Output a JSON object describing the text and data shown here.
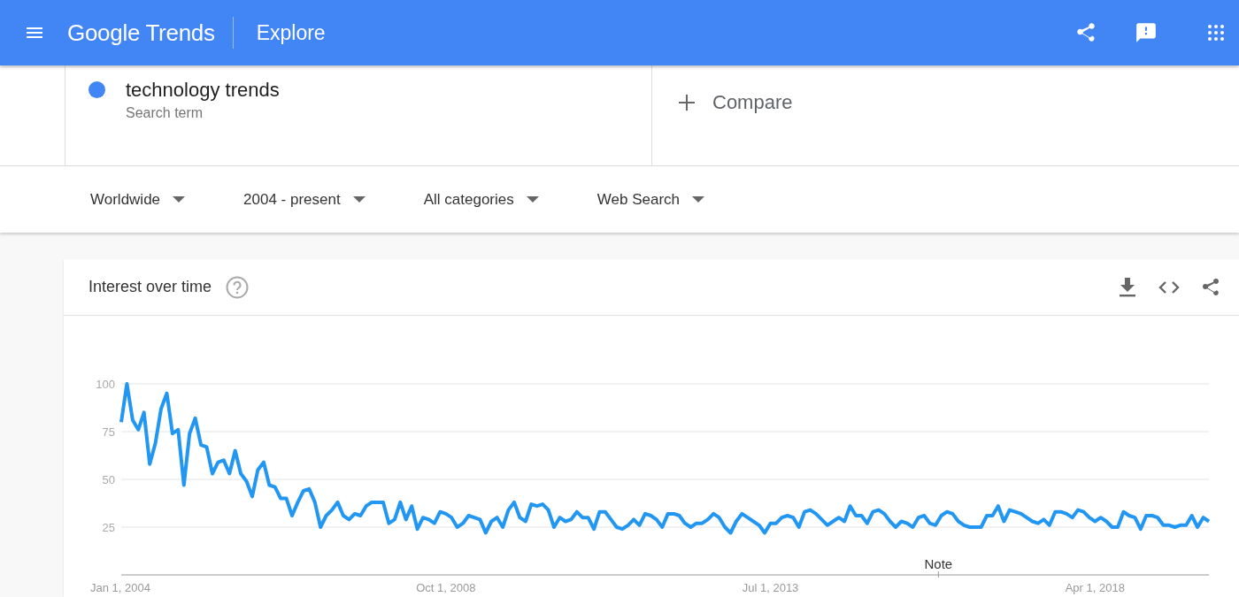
{
  "header": {
    "app_name": "Google Trends",
    "page_title": "Explore"
  },
  "search_terms": [
    {
      "term": "technology trends",
      "subtitle": "Search term",
      "color": "#4285f4"
    }
  ],
  "compare": {
    "label": "Compare"
  },
  "filters": [
    {
      "label": "Worldwide"
    },
    {
      "label": "2004 - present"
    },
    {
      "label": "All categories"
    },
    {
      "label": "Web Search"
    }
  ],
  "interest_over_time": {
    "title": "Interest over time",
    "chart_data": {
      "type": "line",
      "grid": true,
      "ylim": [
        0,
        100
      ],
      "yticks": [
        25,
        50,
        75,
        100
      ],
      "categories": [
        "Jan 1, 2004",
        null,
        null,
        null,
        null,
        null,
        null,
        null,
        null,
        null,
        null,
        null,
        null,
        null,
        null,
        null,
        null,
        null,
        null,
        null,
        null,
        null,
        null,
        null,
        null,
        null,
        null,
        null,
        null,
        null,
        null,
        null,
        null,
        null,
        null,
        null,
        null,
        null,
        null,
        null,
        null,
        null,
        null,
        null,
        null,
        null,
        null,
        null,
        null,
        null,
        null,
        null,
        null,
        null,
        null,
        null,
        null,
        "Oct 1, 2008",
        null,
        null,
        null,
        null,
        null,
        null,
        null,
        null,
        null,
        null,
        null,
        null,
        null,
        null,
        null,
        null,
        null,
        null,
        null,
        null,
        null,
        null,
        null,
        null,
        null,
        null,
        null,
        null,
        null,
        null,
        null,
        null,
        null,
        null,
        null,
        null,
        null,
        null,
        null,
        null,
        null,
        null,
        null,
        null,
        null,
        null,
        null,
        null,
        null,
        null,
        null,
        null,
        null,
        null,
        null,
        null,
        "Jul 1, 2013",
        null,
        null,
        null,
        null,
        null,
        null,
        null,
        null,
        null,
        null,
        null,
        null,
        null,
        null,
        null,
        null,
        null,
        null,
        null,
        null,
        null,
        null,
        null,
        null,
        null,
        null,
        null,
        null,
        null,
        null,
        null,
        null,
        null,
        null,
        null,
        null,
        null,
        null,
        null,
        null,
        null,
        null,
        null,
        null,
        null,
        null,
        null,
        null,
        null,
        null,
        null,
        null,
        null,
        null,
        null,
        null,
        "Apr 1, 2018",
        null,
        null,
        null,
        null,
        null,
        null,
        null,
        null,
        null,
        null,
        null,
        null,
        null,
        null,
        null,
        null,
        null,
        null,
        null,
        null
      ],
      "series": [
        {
          "color": "#2196f3",
          "values": [
            80,
            100,
            81,
            76,
            85,
            58,
            69,
            87,
            95,
            74,
            76,
            47,
            74,
            82,
            68,
            67,
            53,
            59,
            60,
            53,
            65,
            53,
            49,
            41,
            55,
            59,
            47,
            46,
            40,
            40,
            31,
            38,
            44,
            45,
            38,
            25,
            31,
            34,
            38,
            31,
            29,
            32,
            31,
            36,
            38,
            38,
            38,
            27,
            29,
            38,
            29,
            36,
            24,
            30,
            29,
            27,
            33,
            32,
            30,
            25,
            27,
            31,
            30,
            29,
            22,
            28,
            30,
            25,
            34,
            38,
            30,
            28,
            37,
            36,
            37,
            34,
            25,
            30,
            28,
            29,
            33,
            30,
            30,
            24,
            33,
            33,
            29,
            25,
            24,
            26,
            29,
            26,
            32,
            31,
            29,
            25,
            32,
            32,
            31,
            27,
            25,
            27,
            27,
            29,
            32,
            30,
            25,
            22,
            28,
            32,
            30,
            28,
            26,
            22,
            27,
            27,
            30,
            31,
            30,
            25,
            33,
            34,
            32,
            29,
            26,
            28,
            30,
            28,
            36,
            31,
            31,
            27,
            33,
            34,
            32,
            28,
            25,
            28,
            27,
            25,
            30,
            31,
            27,
            26,
            31,
            33,
            32,
            28,
            26,
            25,
            25,
            25,
            31,
            31,
            36,
            28,
            34,
            33,
            32,
            30,
            28,
            27,
            29,
            26,
            33,
            33,
            32,
            30,
            34,
            33,
            30,
            28,
            30,
            28,
            25,
            25,
            33,
            31,
            30,
            24,
            31,
            31,
            30,
            26,
            26,
            25,
            26,
            26,
            31,
            25,
            30,
            28
          ]
        }
      ],
      "annotations": [
        "Note"
      ]
    }
  }
}
